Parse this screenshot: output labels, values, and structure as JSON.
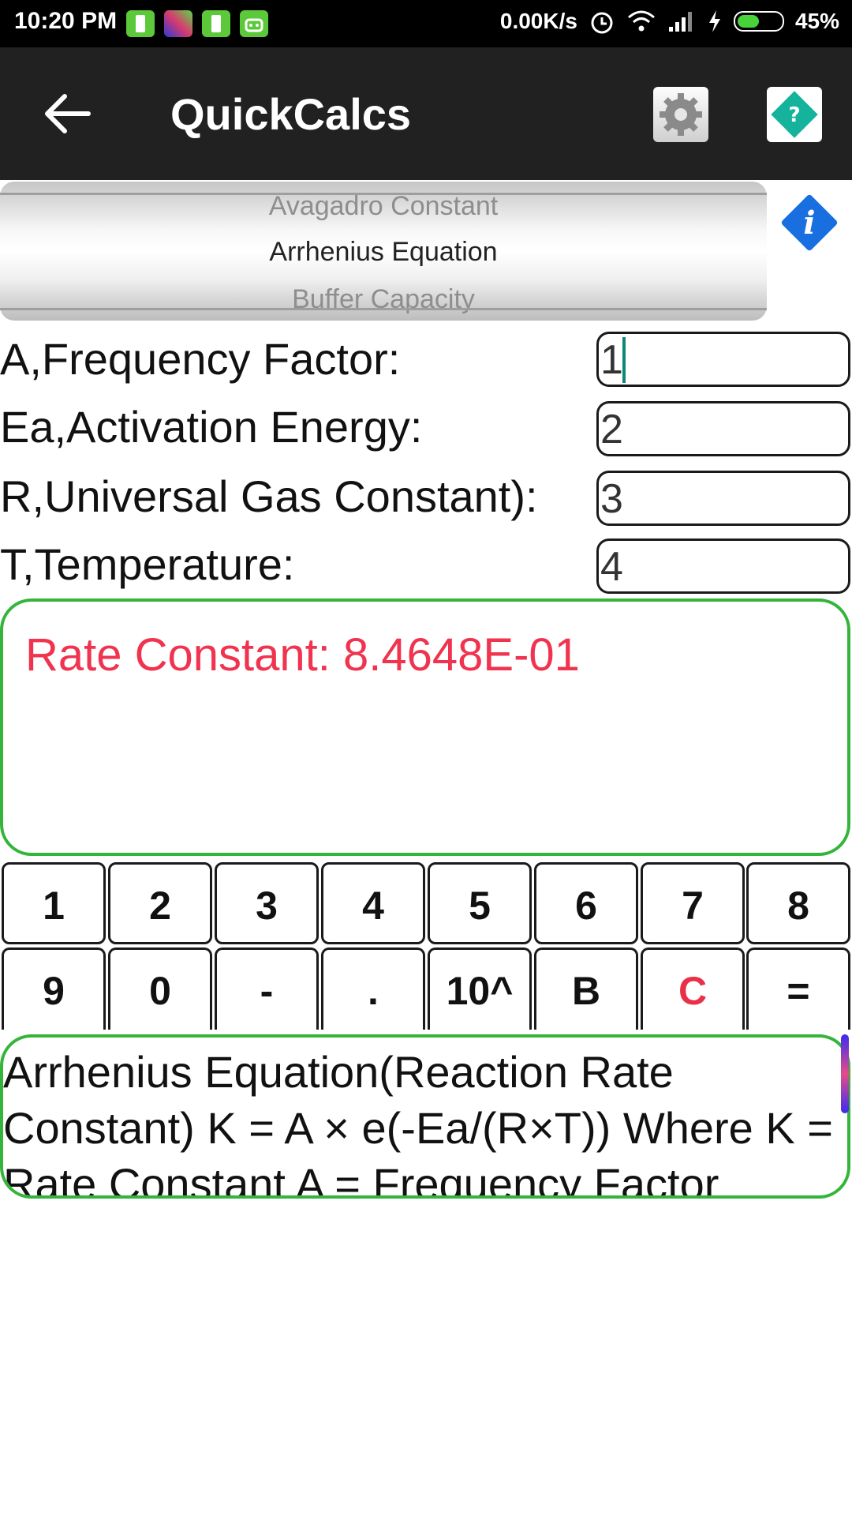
{
  "status_bar": {
    "time": "10:20 PM",
    "network_speed": "0.00K/s",
    "battery_percent": "45%",
    "battery_level": 0.45,
    "icons": [
      "battery-notif-icon",
      "app-notif-icon",
      "battery-notif-icon",
      "android-notif-icon",
      "alarm-icon",
      "wifi-icon",
      "signal-icon",
      "charging-icon",
      "battery-icon"
    ]
  },
  "app_bar": {
    "title": "QuickCalcs",
    "back_icon": "arrow-left-icon",
    "settings_icon": "gear-icon",
    "help_icon": "help-diamond-icon"
  },
  "picker": {
    "items": [
      "Avagadro Constant",
      "Arrhenius Equation",
      "Buffer Capacity"
    ],
    "selected": "Arrhenius Equation",
    "info_icon": "info-icon"
  },
  "fields": [
    {
      "label": "A,Frequency Factor:",
      "value": "1"
    },
    {
      "label": "Ea,Activation Energy:",
      "value": "2"
    },
    {
      "label": "R,Universal Gas Constant):",
      "value": "3"
    },
    {
      "label": "T,Temperature:",
      "value": "4"
    }
  ],
  "result": {
    "text": "Rate Constant: 8.4648E-01"
  },
  "keypad": {
    "row1": [
      "1",
      "2",
      "3",
      "4",
      "5",
      "6",
      "7",
      "8"
    ],
    "row2": [
      "9",
      "0",
      "-",
      ".",
      "10^",
      "B",
      "C",
      "="
    ]
  },
  "description": {
    "text": "Arrhenius Equation(Reaction Rate Constant) K = A × e(-Ea/(R×T)) Where K = Rate Constant A = Frequency Factor"
  },
  "colors": {
    "accent_green": "#34b53a",
    "result_red": "#f0334f",
    "appbar": "#212121"
  }
}
